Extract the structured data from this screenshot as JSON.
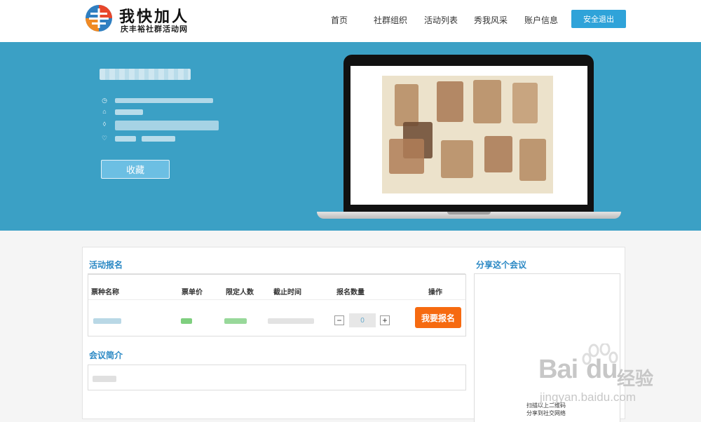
{
  "brand": {
    "title": "我快加人",
    "subtitle": "庆丰裕社群活动网"
  },
  "nav": {
    "items": [
      "首页",
      "社群组织",
      "活动列表",
      "秀我风采",
      "账户信息"
    ],
    "logout_label": "安全退出"
  },
  "banner": {
    "favorite_label": "收藏",
    "icons": [
      "clock-icon",
      "building-icon",
      "location-pin-icon",
      "heart-icon"
    ]
  },
  "registration": {
    "section_title": "活动报名",
    "columns": [
      "票种名称",
      "票单价",
      "限定人数",
      "截止时间",
      "报名数量",
      "操作"
    ],
    "quantity_value": "0",
    "minus_label": "−",
    "plus_label": "+",
    "signup_label": "我要报名"
  },
  "intro": {
    "section_title": "会议简介"
  },
  "share": {
    "section_title": "分享这个会议",
    "qr_caption_line1": "扫描以上二维码",
    "qr_caption_line2": "分享到社交网络"
  },
  "watermark": {
    "brand": "Bai",
    "brand_tail": "du",
    "cn": "经验",
    "url": "jingyan.baidu.com"
  },
  "colors": {
    "banner_bg": "#3ba0c5",
    "accent": "#2a88c4",
    "signup": "#f66a10",
    "logout": "#2fa3d9"
  }
}
